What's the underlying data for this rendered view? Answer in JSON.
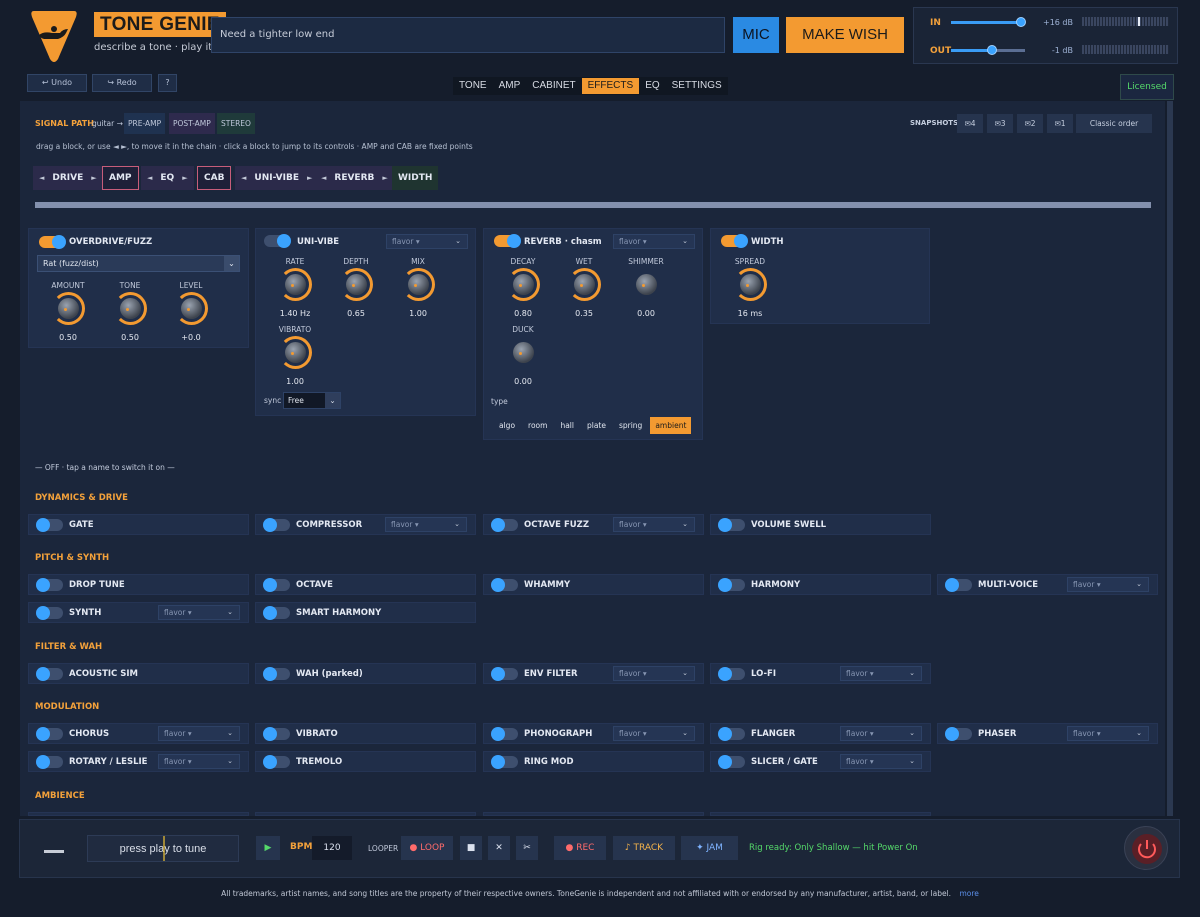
{
  "app": {
    "title": "TONE GENIE",
    "tagline": "describe a tone · play it live"
  },
  "wish": {
    "placeholder": "Need a tighter low end",
    "mic_label": "MIC",
    "make_wish_label": "MAKE WISH"
  },
  "io": {
    "in_label": "IN",
    "in_value": "+16 dB",
    "in_level": 0.95,
    "out_label": "OUT",
    "out_value": "-1 dB",
    "out_level": 0.55
  },
  "toolbar": {
    "undo": "↩ Undo",
    "redo": "↪ Redo",
    "help": "?"
  },
  "tabs": [
    {
      "label": "TONE",
      "active": false
    },
    {
      "label": "AMP",
      "active": false
    },
    {
      "label": "CABINET",
      "active": false
    },
    {
      "label": "EFFECTS",
      "active": true
    },
    {
      "label": "EQ",
      "active": false
    },
    {
      "label": "SETTINGS",
      "active": false
    }
  ],
  "license": "Licensed",
  "signal_path": {
    "label": "SIGNAL PATH",
    "source": "guitar →",
    "chips": [
      "PRE-AMP",
      "POST-AMP",
      "STEREO"
    ],
    "hint": "drag a block, or use ◄ ►, to move it in the chain · click a block to jump to its controls · AMP and CAB are fixed points",
    "chain": [
      {
        "label": "DRIVE",
        "fixed": false
      },
      {
        "label": "AMP",
        "fixed": true
      },
      {
        "label": "EQ",
        "fixed": false
      },
      {
        "label": "CAB",
        "fixed": true
      },
      {
        "label": "UNI-VIBE",
        "fixed": false
      },
      {
        "label": "REVERB",
        "fixed": false
      },
      {
        "label": "WIDTH",
        "fixed": false
      }
    ],
    "snapshots_label": "SNAPSHOTS",
    "snapshots": [
      "✉4",
      "✉3",
      "✉2",
      "✉1"
    ],
    "classic_order": "Classic order"
  },
  "active_panels": {
    "drive": {
      "name": "OVERDRIVE/FUZZ",
      "mode": "Rat (fuzz/dist)",
      "knobs": [
        {
          "label": "AMOUNT",
          "value": "0.50"
        },
        {
          "label": "TONE",
          "value": "0.50"
        },
        {
          "label": "LEVEL",
          "value": "+0.0"
        }
      ]
    },
    "univibe": {
      "name": "UNI-VIBE",
      "flavor": "flavor ▾",
      "knobs": [
        {
          "label": "RATE",
          "value": "1.40 Hz"
        },
        {
          "label": "DEPTH",
          "value": "0.65"
        },
        {
          "label": "MIX",
          "value": "1.00"
        },
        {
          "label": "VIBRATO",
          "value": "1.00"
        }
      ],
      "sync_label": "sync",
      "sync_value": "Free"
    },
    "reverb": {
      "name": "REVERB · chasm",
      "flavor": "flavor ▾",
      "knobs": [
        {
          "label": "DECAY",
          "value": "0.80"
        },
        {
          "label": "WET",
          "value": "0.35"
        },
        {
          "label": "SHIMMER",
          "value": "0.00"
        },
        {
          "label": "DUCK",
          "value": "0.00"
        }
      ],
      "type_label": "type",
      "types": [
        "algo",
        "room",
        "hall",
        "plate",
        "spring",
        "ambient"
      ],
      "type_selected": "ambient"
    },
    "width": {
      "name": "WIDTH",
      "knobs": [
        {
          "label": "SPREAD",
          "value": "16 ms"
        }
      ]
    }
  },
  "off_hint": "— OFF · tap a name to switch it on —",
  "sections": [
    {
      "title": "DYNAMICS & DRIVE",
      "rows": [
        [
          {
            "name": "GATE",
            "flavor": null
          },
          {
            "name": "COMPRESSOR",
            "flavor": "flavor ▾"
          },
          {
            "name": "OCTAVE FUZZ",
            "flavor": "flavor ▾"
          },
          {
            "name": "VOLUME SWELL",
            "flavor": null
          }
        ]
      ]
    },
    {
      "title": "PITCH & SYNTH",
      "rows": [
        [
          {
            "name": "DROP TUNE",
            "flavor": null
          },
          {
            "name": "OCTAVE",
            "flavor": null
          },
          {
            "name": "WHAMMY",
            "flavor": null
          },
          {
            "name": "HARMONY",
            "flavor": null
          },
          {
            "name": "MULTI-VOICE",
            "flavor": "flavor ▾"
          }
        ],
        [
          {
            "name": "SYNTH",
            "flavor": "flavor ▾"
          },
          {
            "name": "SMART HARMONY",
            "flavor": null
          }
        ]
      ]
    },
    {
      "title": "FILTER & WAH",
      "rows": [
        [
          {
            "name": "ACOUSTIC SIM",
            "flavor": null
          },
          {
            "name": "WAH (parked)",
            "flavor": null
          },
          {
            "name": "ENV FILTER",
            "flavor": "flavor ▾"
          },
          {
            "name": "LO-FI",
            "flavor": "flavor ▾"
          }
        ]
      ]
    },
    {
      "title": "MODULATION",
      "rows": [
        [
          {
            "name": "CHORUS",
            "flavor": "flavor ▾"
          },
          {
            "name": "VIBRATO",
            "flavor": null
          },
          {
            "name": "PHONOGRAPH",
            "flavor": "flavor ▾"
          },
          {
            "name": "FLANGER",
            "flavor": "flavor ▾"
          },
          {
            "name": "PHASER",
            "flavor": "flavor ▾"
          }
        ],
        [
          {
            "name": "ROTARY / LESLIE",
            "flavor": "flavor ▾"
          },
          {
            "name": "TREMOLO",
            "flavor": null
          },
          {
            "name": "RING MOD",
            "flavor": null
          },
          {
            "name": "SLICER / GATE",
            "flavor": "flavor ▾"
          }
        ]
      ]
    },
    {
      "title": "AMBIENCE",
      "rows": []
    }
  ],
  "bottom": {
    "tuner": "press play to tune",
    "play": "▶",
    "bpm_label": "BPM",
    "bpm_value": "120",
    "looper_label": "LOOPER",
    "loop": "● LOOP",
    "stop": "■",
    "clear": "✕",
    "cut": "✂",
    "rec": "● REC",
    "track": "♪ TRACK",
    "jam": "✦ JAM",
    "status": "Rig ready: Only Shallow — hit Power On"
  },
  "footer": {
    "text": "All trademarks, artist names, and song titles are the property of their respective owners. ToneGenie is independent and not affiliated with or endorsed by any manufacturer, artist, band, or label.",
    "more": "more"
  }
}
